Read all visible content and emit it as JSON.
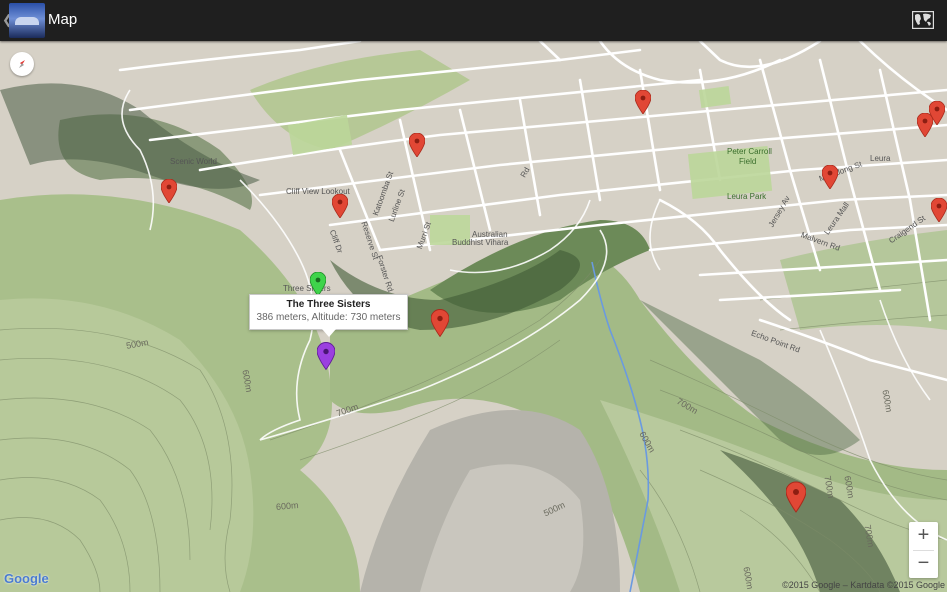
{
  "app_bar": {
    "title": "Map",
    "back": "❮",
    "action_icon": "world-map-icon"
  },
  "map": {
    "street_labels": {
      "scenic_world": "Scenic World",
      "cliff_view": "Cliff View Lookout",
      "australian": "Australian",
      "buddhist": "Buddhist Vihara",
      "peter_carroll": "Peter Carroll",
      "field": "Field",
      "leura_park": "Leura Park",
      "leura": "Leura",
      "three_sisters": "Three Sisters",
      "katoomba_st": "Katoomba St",
      "lurline_st": "Lurline St",
      "murri_st": "Murri St",
      "cliff_dr": "Cliff Dr",
      "reserve_st": "Reserve St",
      "forster_rd": "Forster Rd",
      "rd": "Rd",
      "echo_point_rd": "Echo Point Rd",
      "malvern_rd": "Malvern Rd",
      "craigend_st": "Craigend St",
      "megalong_st": "Megalong St",
      "jersey_av": "Jersey Av",
      "leura_mall": "Leura Mall"
    },
    "contours": [
      "500m",
      "600m",
      "700m",
      "600m",
      "500m",
      "600m",
      "700m",
      "600m",
      "700m",
      "600m",
      "700m",
      "600m"
    ],
    "info_window": {
      "title": "The Three Sisters",
      "subtitle": "386 meters, Altitude: 730 meters"
    },
    "colors": {
      "marker_red": "#e14735",
      "marker_green": "#3fd44b",
      "marker_purple": "#9b3fe0"
    }
  },
  "controls": {
    "zoom_in": "+",
    "zoom_out": "−"
  },
  "attribution": {
    "logo": "Google",
    "copyright": "©2015 Google – Kartdata ©2015 Google"
  }
}
